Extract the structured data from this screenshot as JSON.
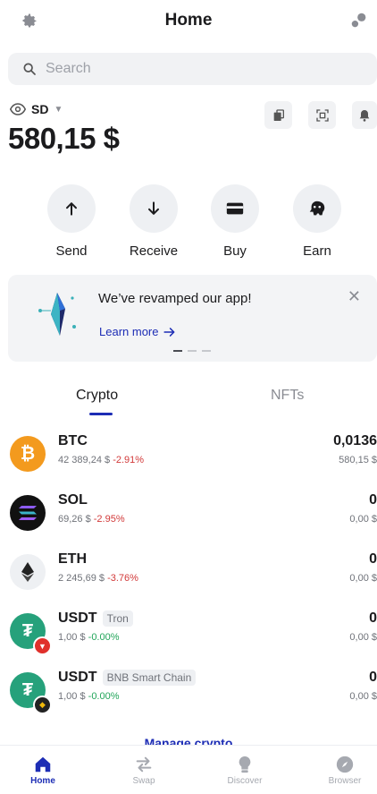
{
  "header": {
    "title": "Home",
    "settings_icon": "gear-icon",
    "right_icon": "dots-icon"
  },
  "search": {
    "placeholder": "Search"
  },
  "wallet": {
    "name": "SD",
    "balance": "580,15 $"
  },
  "actions": [
    {
      "label": "Send",
      "icon": "arrow-up-icon"
    },
    {
      "label": "Receive",
      "icon": "arrow-down-icon"
    },
    {
      "label": "Buy",
      "icon": "card-icon"
    },
    {
      "label": "Earn",
      "icon": "piggy-icon"
    }
  ],
  "banner": {
    "headline": "We’ve revamped our app!",
    "link": "Learn more"
  },
  "tabs": [
    {
      "label": "Crypto"
    },
    {
      "label": "NFTs"
    }
  ],
  "tokens": [
    {
      "symbol": "BTC",
      "network": "",
      "price": "42 389,24 $",
      "change": "-2.91%",
      "amount": "0,0136",
      "fiat": "580,15 $"
    },
    {
      "symbol": "SOL",
      "network": "",
      "price": "69,26 $",
      "change": "-2.95%",
      "amount": "0",
      "fiat": "0,00 $"
    },
    {
      "symbol": "ETH",
      "network": "",
      "price": "2 245,69 $",
      "change": "-3.76%",
      "amount": "0",
      "fiat": "0,00 $"
    },
    {
      "symbol": "USDT",
      "network": "Tron",
      "price": "1,00 $",
      "change": "-0.00%",
      "amount": "0",
      "fiat": "0,00 $"
    },
    {
      "symbol": "USDT",
      "network": "BNB Smart Chain",
      "price": "1,00 $",
      "change": "-0.00%",
      "amount": "0",
      "fiat": "0,00 $"
    }
  ],
  "manage_link": "Manage crypto",
  "nav": [
    {
      "label": "Home"
    },
    {
      "label": "Swap"
    },
    {
      "label": "Discover"
    },
    {
      "label": "Browser"
    }
  ],
  "colors": {
    "accent": "#1d2db5",
    "negative": "#d23a3a",
    "positive": "#22a55a"
  }
}
